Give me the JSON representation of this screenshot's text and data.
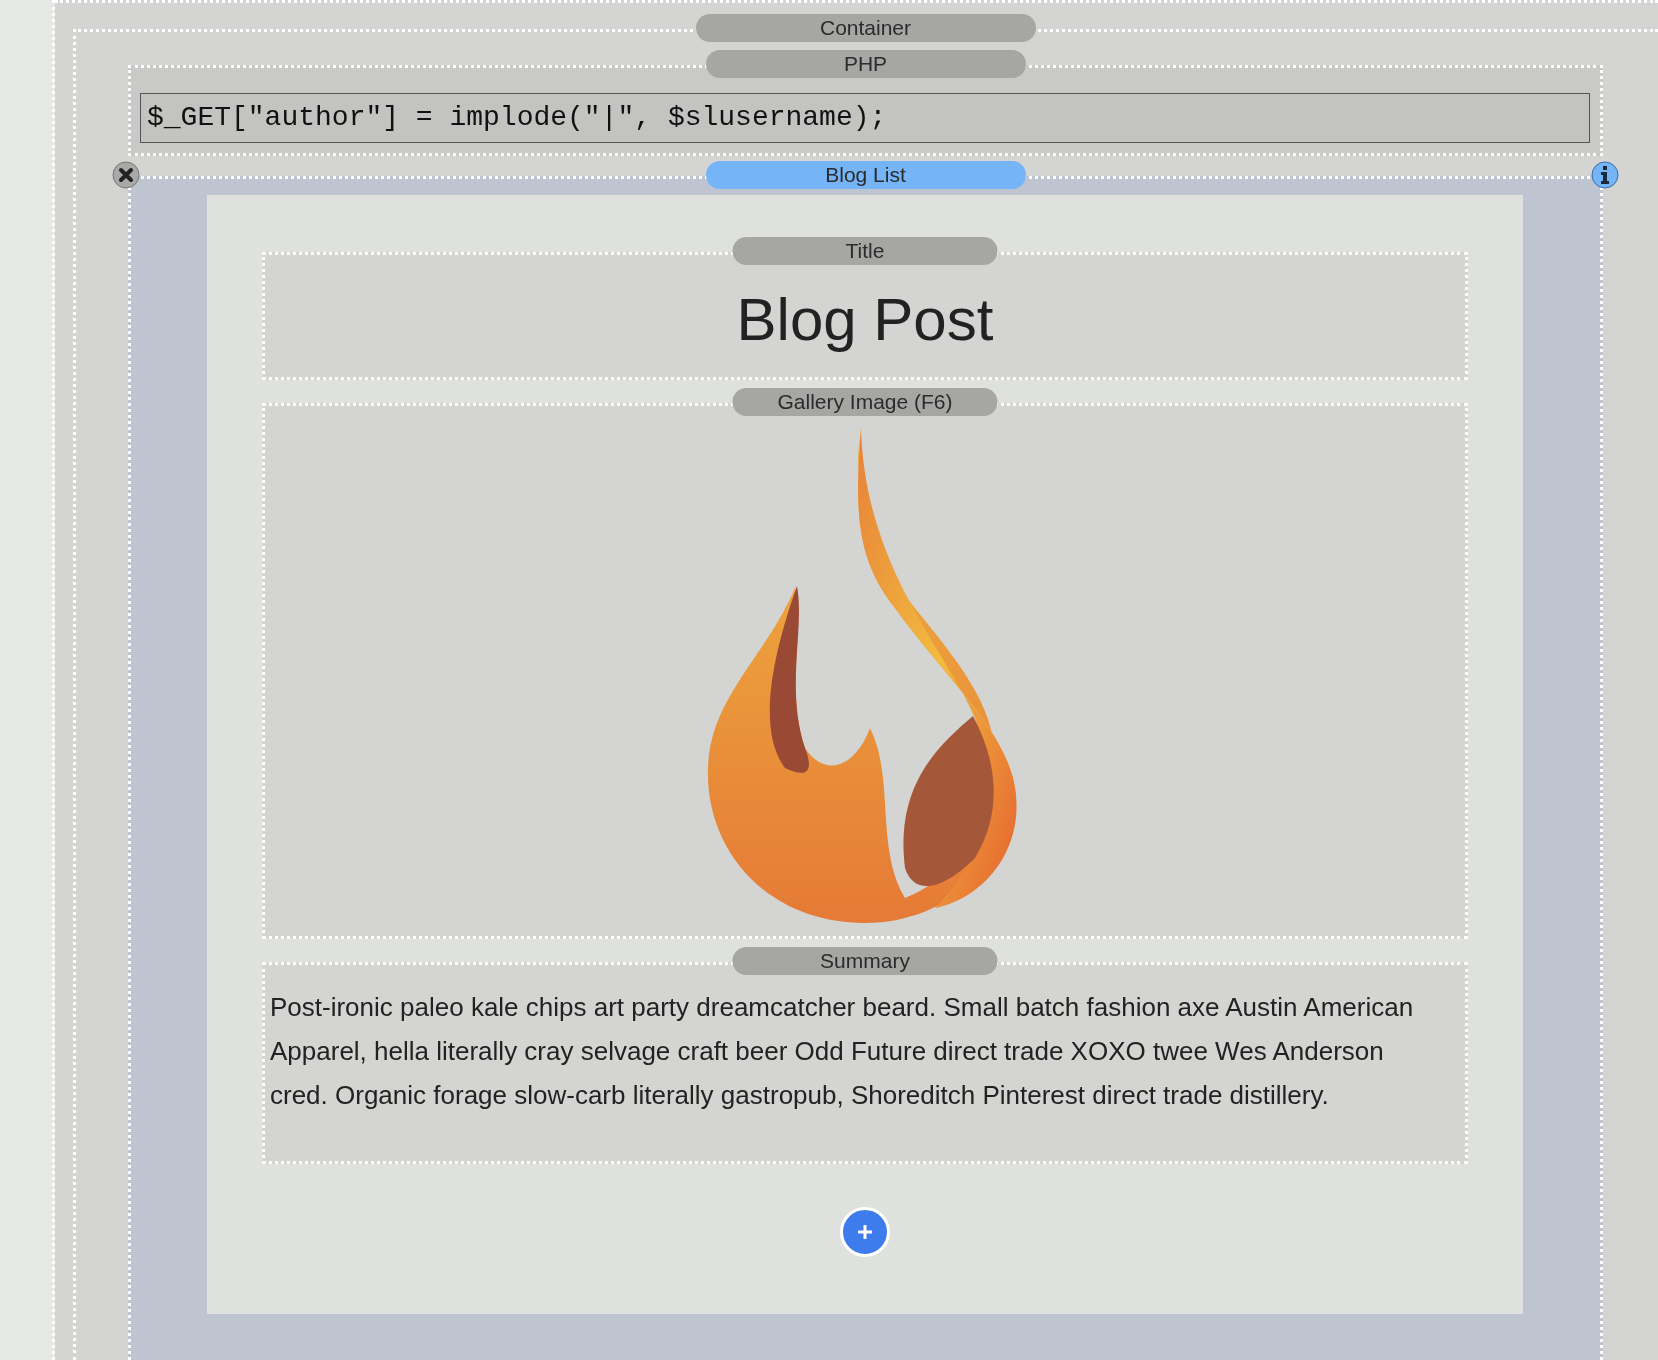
{
  "container": {
    "label": "Container"
  },
  "php": {
    "label": "PHP",
    "code": "$_GET[\"author\"] = implode(\"|\", $slusername);"
  },
  "blog_list": {
    "label": "Blog List",
    "selected": true,
    "title_block": {
      "label": "Title",
      "text": "Blog Post"
    },
    "gallery_block": {
      "label": "Gallery Image (F6)"
    },
    "summary_block": {
      "label": "Summary",
      "text": "Post-ironic paleo kale chips art party dreamcatcher beard. Small batch fashion axe Austin American Apparel, hella literally cray selvage craft beer Odd Future direct trade XOXO twee Wes Anderson cred. Organic forage slow-carb literally gastropub, Shoreditch Pinterest direct trade distillery."
    }
  }
}
